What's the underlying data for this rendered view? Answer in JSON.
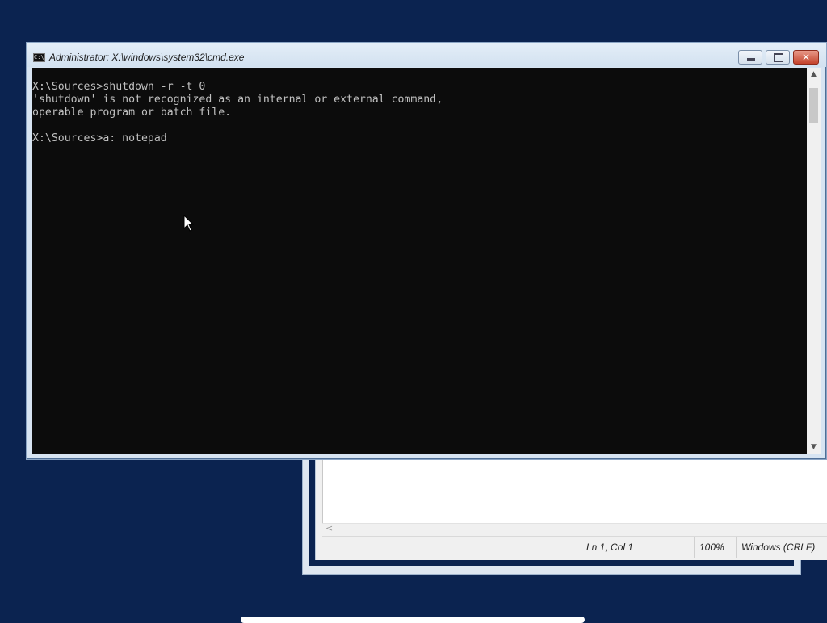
{
  "cmd_window": {
    "title": "Administrator: X:\\windows\\system32\\cmd.exe",
    "icon": "cmd-icon",
    "icon_text": "C:\\.",
    "console_lines": [
      "X:\\Sources>shutdown -r -t 0",
      "'shutdown' is not recognized as an internal or external command,",
      "operable program or batch file.",
      "",
      "X:\\Sources>a: notepad"
    ],
    "buttons": {
      "minimize": "minimize",
      "maximize": "maximize",
      "close": "✕"
    }
  },
  "notepad_window": {
    "status": {
      "position": "Ln 1, Col 1",
      "zoom": "100%",
      "line_ending": "Windows (CRLF)"
    },
    "hscroll_arrow": "<"
  },
  "colors": {
    "desktop": "#0b2350",
    "console_bg": "#0c0c0c",
    "console_text": "#c0c0c0"
  }
}
